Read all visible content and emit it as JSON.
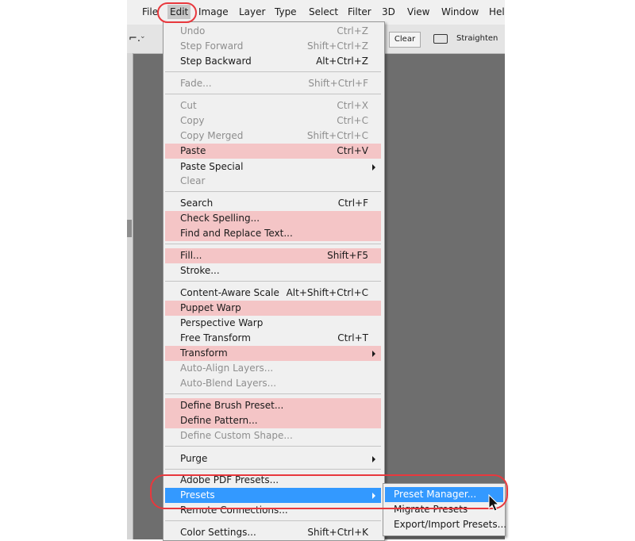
{
  "menubar": {
    "items": [
      "File",
      "Edit",
      "Image",
      "Layer",
      "Type",
      "Select",
      "Filter",
      "3D",
      "View",
      "Window",
      "Hel"
    ]
  },
  "toolbar": {
    "clear_label": "Clear",
    "straighten_label": "Straighten"
  },
  "edit_menu": {
    "items": [
      {
        "label": "Undo",
        "shortcut": "Ctrl+Z"
      },
      {
        "label": "Step Forward",
        "shortcut": "Shift+Ctrl+Z"
      },
      {
        "label": "Step Backward",
        "shortcut": "Alt+Ctrl+Z"
      },
      {
        "label": "Fade...",
        "shortcut": "Shift+Ctrl+F"
      },
      {
        "label": "Cut",
        "shortcut": "Ctrl+X"
      },
      {
        "label": "Copy",
        "shortcut": "Ctrl+C"
      },
      {
        "label": "Copy Merged",
        "shortcut": "Shift+Ctrl+C"
      },
      {
        "label": "Paste",
        "shortcut": "Ctrl+V"
      },
      {
        "label": "Paste Special",
        "shortcut": ""
      },
      {
        "label": "Clear",
        "shortcut": ""
      },
      {
        "label": "Search",
        "shortcut": "Ctrl+F"
      },
      {
        "label": "Check Spelling...",
        "shortcut": ""
      },
      {
        "label": "Find and Replace Text...",
        "shortcut": ""
      },
      {
        "label": "Fill...",
        "shortcut": "Shift+F5"
      },
      {
        "label": "Stroke...",
        "shortcut": ""
      },
      {
        "label": "Content-Aware Scale",
        "shortcut": "Alt+Shift+Ctrl+C"
      },
      {
        "label": "Puppet Warp",
        "shortcut": ""
      },
      {
        "label": "Perspective Warp",
        "shortcut": ""
      },
      {
        "label": "Free Transform",
        "shortcut": "Ctrl+T"
      },
      {
        "label": "Transform",
        "shortcut": ""
      },
      {
        "label": "Auto-Align Layers...",
        "shortcut": ""
      },
      {
        "label": "Auto-Blend Layers...",
        "shortcut": ""
      },
      {
        "label": "Define Brush Preset...",
        "shortcut": ""
      },
      {
        "label": "Define Pattern...",
        "shortcut": ""
      },
      {
        "label": "Define Custom Shape...",
        "shortcut": ""
      },
      {
        "label": "Purge",
        "shortcut": ""
      },
      {
        "label": "Adobe PDF Presets...",
        "shortcut": ""
      },
      {
        "label": "Presets",
        "shortcut": ""
      },
      {
        "label": "Remote Connections...",
        "shortcut": ""
      },
      {
        "label": "Color Settings...",
        "shortcut": "Shift+Ctrl+K"
      }
    ]
  },
  "presets_submenu": {
    "items": [
      "Preset Manager...",
      "Migrate Presets",
      "Export/Import Presets..."
    ]
  },
  "colors": {
    "highlight": "#f4c5c6",
    "selection": "#3399ff",
    "annotation": "#e8383d"
  }
}
